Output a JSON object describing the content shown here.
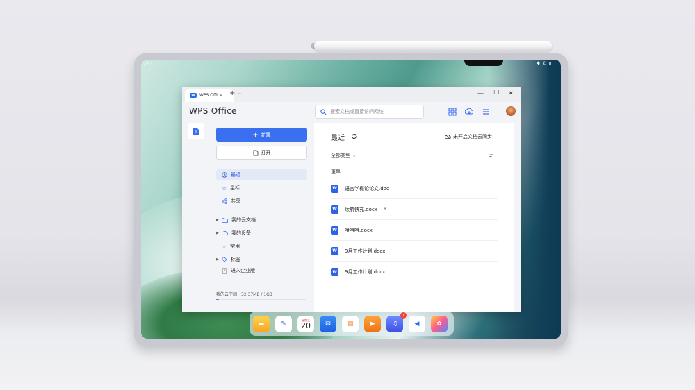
{
  "status": {
    "time": "2:53",
    "right": "✱ ✆ ▮"
  },
  "tab": {
    "label": "WPS Office",
    "logo_text": "W"
  },
  "header": {
    "logo": "WPS Office",
    "search_placeholder": "搜索文档或直接访问网址"
  },
  "sidebar": {
    "new_label": "新建",
    "open_label": "打开",
    "items": [
      {
        "label": "最近"
      },
      {
        "label": "星标"
      },
      {
        "label": "共享"
      },
      {
        "label": "我的云文档"
      },
      {
        "label": "我的设备"
      },
      {
        "label": "常用"
      },
      {
        "label": "标签"
      },
      {
        "label": "进入企业版"
      }
    ],
    "quota": "我的云空间：32.37MB / 1GB",
    "quota_fraction": 0.032
  },
  "main": {
    "title": "最近",
    "sync": "未开启文档云同步",
    "filter": "全部类型",
    "section": "更早",
    "files": [
      {
        "name": "语言学概论论文.doc",
        "icon": "W"
      },
      {
        "name": "续航快充.docx",
        "icon": "W",
        "extra": "8"
      },
      {
        "name": "哈哈哈.docx",
        "icon": "W"
      },
      {
        "name": "9月工作计划.docx",
        "icon": "W"
      },
      {
        "name": "9月工作计划.docx",
        "icon": "W"
      }
    ]
  },
  "dock": {
    "calendar_day": "20",
    "calendar_weekday": "星期三",
    "music_badge": "1"
  },
  "colors": {
    "accent": "#3a6ff0",
    "word_blue": "#2f63e6"
  }
}
